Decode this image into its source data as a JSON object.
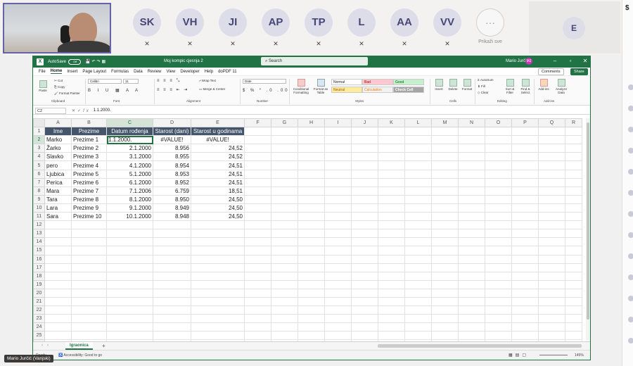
{
  "teams": {
    "participants": [
      {
        "initials": "SK"
      },
      {
        "initials": "VH"
      },
      {
        "initials": "JI"
      },
      {
        "initials": "AP"
      },
      {
        "initials": "TP"
      },
      {
        "initials": "L"
      },
      {
        "initials": "AA"
      },
      {
        "initials": "VV"
      }
    ],
    "more_label": "Prikaži sve",
    "more_glyph": "···",
    "spotlight_initial": "E",
    "presenter_name": "Mario Jurčić (Vanjski)",
    "mic_off_glyph": "✕"
  },
  "excel": {
    "autosave_label": "AutoSave",
    "autosave_state": "Off",
    "file_name": "Moj kompic cjesnja 2",
    "search_placeholder": "Search",
    "user_name": "Mario Jurčić",
    "user_initials": "MJ",
    "menu_tabs": [
      "File",
      "Home",
      "Insert",
      "Page Layout",
      "Formulas",
      "Data",
      "Review",
      "View",
      "Developer",
      "Help",
      "doPDF 11"
    ],
    "comments_label": "Comments",
    "share_label": "Share",
    "ribbon": {
      "paste": "Paste",
      "cut": "Cut",
      "copy": "Copy",
      "format_painter": "Format Painter",
      "font_name": "Calibri",
      "font_size": "11",
      "wrap_text": "Wrap Text",
      "merge_center": "Merge & Center",
      "number_format": "Date",
      "conditional": "Conditional Formatting",
      "format_table": "Format as Table",
      "styles": [
        "Normal",
        "Bad",
        "Good",
        "Neutral",
        "Calculation",
        "Check Cell"
      ],
      "insert": "Insert",
      "delete": "Delete",
      "format": "Format",
      "autosum": "AutoSum",
      "fill": "Fill",
      "clear": "Clear",
      "sort_filter": "Sort & Filter",
      "find_select": "Find & Select",
      "addins": "Add-ins",
      "analyze": "Analyze Data",
      "group_labels": [
        "Clipboard",
        "Font",
        "Alignment",
        "Number",
        "Styles",
        "Cells",
        "Editing",
        "Add-ins"
      ]
    },
    "name_box": "C2",
    "formula": "1.1.2000.",
    "column_headers": [
      "A",
      "B",
      "C",
      "D",
      "E",
      "F",
      "G",
      "H",
      "I",
      "J",
      "K",
      "L",
      "M",
      "N",
      "O",
      "P",
      "Q",
      "R"
    ],
    "row_numbers": [
      "1",
      "2",
      "3",
      "4",
      "5",
      "6",
      "7",
      "8",
      "9",
      "10",
      "11",
      "12",
      "13",
      "14",
      "15",
      "16",
      "17",
      "18",
      "19",
      "20",
      "21",
      "22",
      "23",
      "24",
      "25",
      "26"
    ],
    "table_headers": [
      "Ime",
      "Prezime",
      "Datum rođenja",
      "Starost (dani)",
      "Starost u godinama"
    ],
    "rows": [
      [
        "Marko",
        "Prezime 1",
        "1.1.2000.",
        "#VALUE!",
        "#VALUE!"
      ],
      [
        "Žarko",
        "Prezime 2",
        "2.1.2000",
        "8.956",
        "24,52"
      ],
      [
        "Slavko",
        "Prezime 3",
        "3.1.2000",
        "8.955",
        "24,52"
      ],
      [
        "pero",
        "Prezime 4",
        "4.1.2000",
        "8.954",
        "24,51"
      ],
      [
        "Ljubica",
        "Prezime 5",
        "5.1.2000",
        "8.953",
        "24,51"
      ],
      [
        "Perica",
        "Prezime 6",
        "6.1.2000",
        "8.952",
        "24,51"
      ],
      [
        "Mara",
        "Prezime 7",
        "7.1.2006",
        "6.759",
        "18,51"
      ],
      [
        "Tara",
        "Prezime 8",
        "8.1.2000",
        "8.950",
        "24,50"
      ],
      [
        "Lara",
        "Prezime 9",
        "9.1.2000",
        "8.949",
        "24,50"
      ],
      [
        "Sara",
        "Prezime 10",
        "10.1.2000",
        "8.948",
        "24,50"
      ]
    ],
    "sheet_tab": "Igraonica",
    "status_ready": "Ready",
    "status_accessibility": "Accessibility: Good to go",
    "zoom": "145%"
  },
  "colors": {
    "excel_green": "#217346",
    "header_fill": "#44546a",
    "teams_accent": "#6264a7"
  }
}
